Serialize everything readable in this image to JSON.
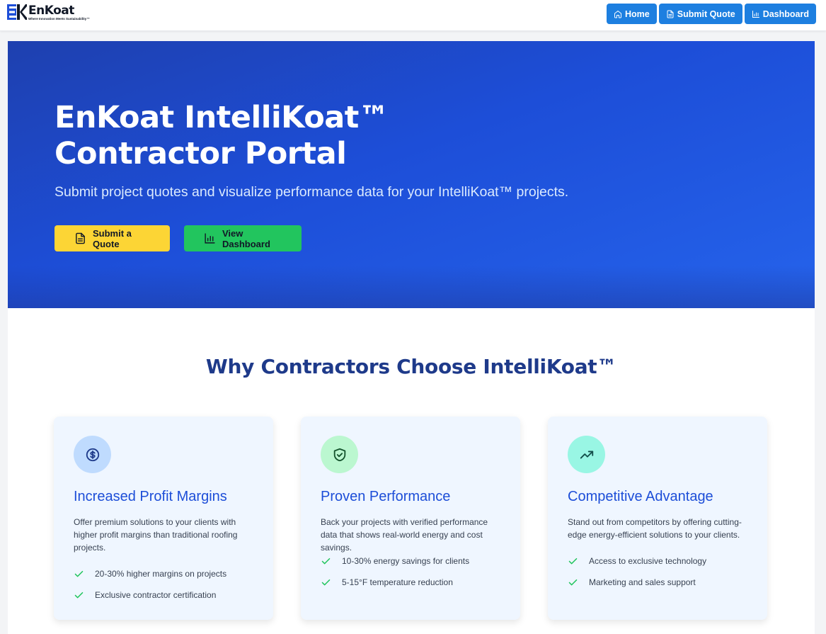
{
  "header": {
    "logo_name": "EnKoat",
    "logo_tagline": "Where Innovation Meets Sustainability™",
    "nav": [
      {
        "label": "Home",
        "icon": "home-icon"
      },
      {
        "label": "Submit Quote",
        "icon": "document-icon"
      },
      {
        "label": "Dashboard",
        "icon": "bar-chart-icon"
      }
    ]
  },
  "hero": {
    "title_line1": "EnKoat IntelliKoat™",
    "title_line2": "Contractor Portal",
    "subtitle": "Submit project quotes and visualize performance data for your IntelliKoat™ projects.",
    "quote_button": "Submit a Quote",
    "dashboard_button": "View Dashboard"
  },
  "why": {
    "title": "Why Contractors Choose IntelliKoat™",
    "cards": [
      {
        "icon": "dollar-icon",
        "title": "Increased Profit Margins",
        "description": "Offer premium solutions to your clients with higher profit margins than traditional roofing projects.",
        "bullets": [
          "20-30% higher margins on projects",
          "Exclusive contractor certification"
        ]
      },
      {
        "icon": "shield-check-icon",
        "title": "Proven Performance",
        "description": "Back your projects with verified performance data that shows real-world energy and cost savings.",
        "bullets": [
          "10-30% energy savings for clients",
          "5-15°F temperature reduction"
        ]
      },
      {
        "icon": "trending-up-icon",
        "title": "Competitive Advantage",
        "description": "Stand out from competitors by offering cutting-edge energy-efficient solutions to your clients.",
        "bullets": [
          "Access to exclusive technology",
          "Marketing and sales support"
        ]
      }
    ]
  },
  "colors": {
    "nav_button": "#1d7fe0",
    "hero_bg": "#1d4ed8",
    "quote_button": "#fcd535",
    "dashboard_button": "#22c55e",
    "section_title": "#1e3a8a",
    "card_title": "#1d4ed8",
    "check": "#22c55e"
  }
}
